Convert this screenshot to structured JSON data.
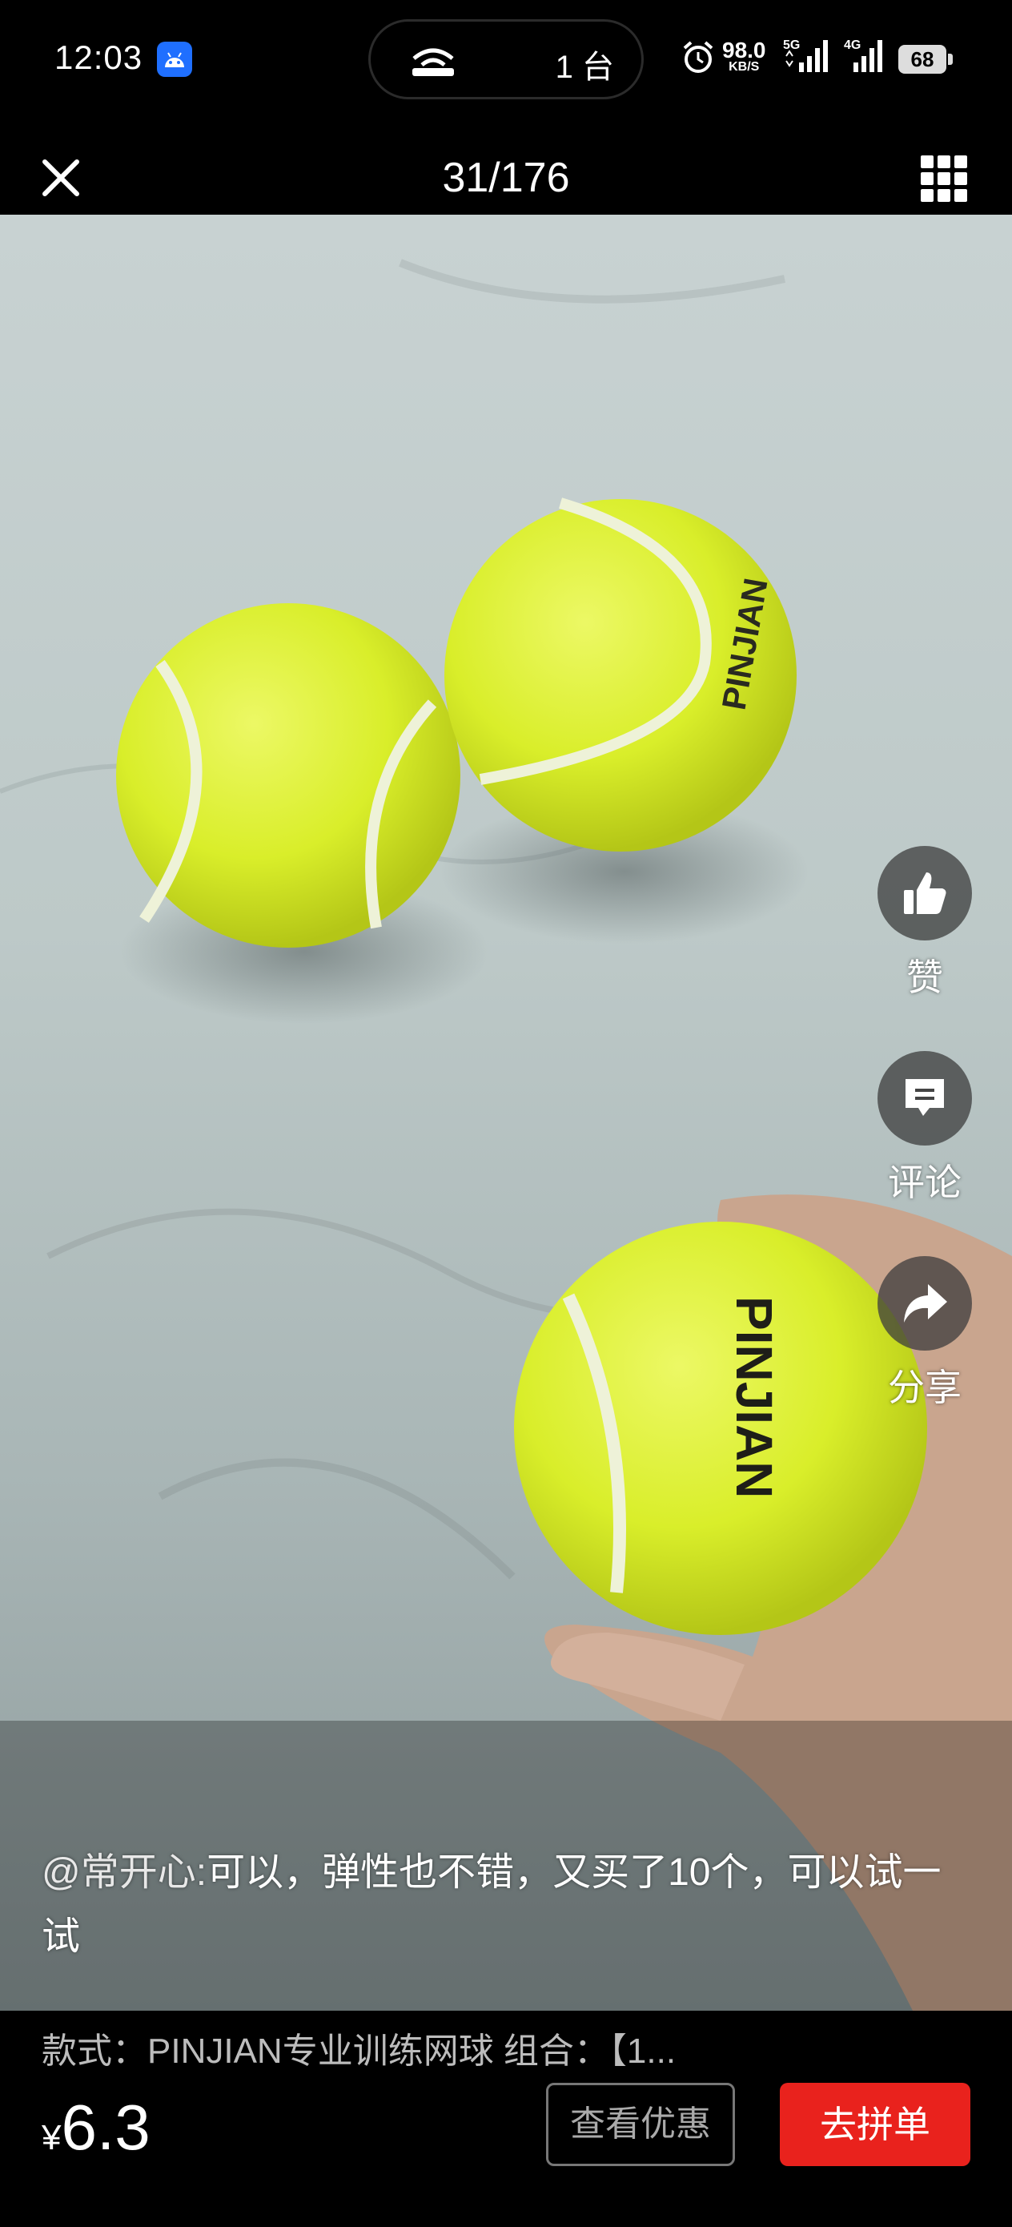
{
  "status_bar": {
    "time": "12:03",
    "connected_devices": "1 台",
    "net_speed": "98.0",
    "net_speed_unit": "KB/S",
    "sim1_type": "5G",
    "sim2_type": "4G",
    "battery": "68",
    "icons": [
      "android-notification-icon",
      "network-share-icon",
      "alarm-icon",
      "signal-icon",
      "battery-icon"
    ]
  },
  "nav": {
    "counter": "31/176",
    "close_icon": "close-icon",
    "grid_icon": "grid-icon"
  },
  "actions": {
    "like_label": "赞",
    "comment_label": "评论",
    "share_label": "分享"
  },
  "review": {
    "user": "@常开心:",
    "text": "可以，弹性也不错，又买了10个，可以试一试"
  },
  "product": {
    "spec": "款式：PINJIAN专业训练网球  组合：【1...",
    "currency": "¥",
    "price": "6.3",
    "coupon_button": "查看优惠",
    "buy_button": "去拼单"
  },
  "photo": {
    "brand_text": "PINJIAN"
  },
  "colors": {
    "background": "#000000",
    "buy_button": "#e9221d",
    "ball": "#d9ee2a"
  }
}
